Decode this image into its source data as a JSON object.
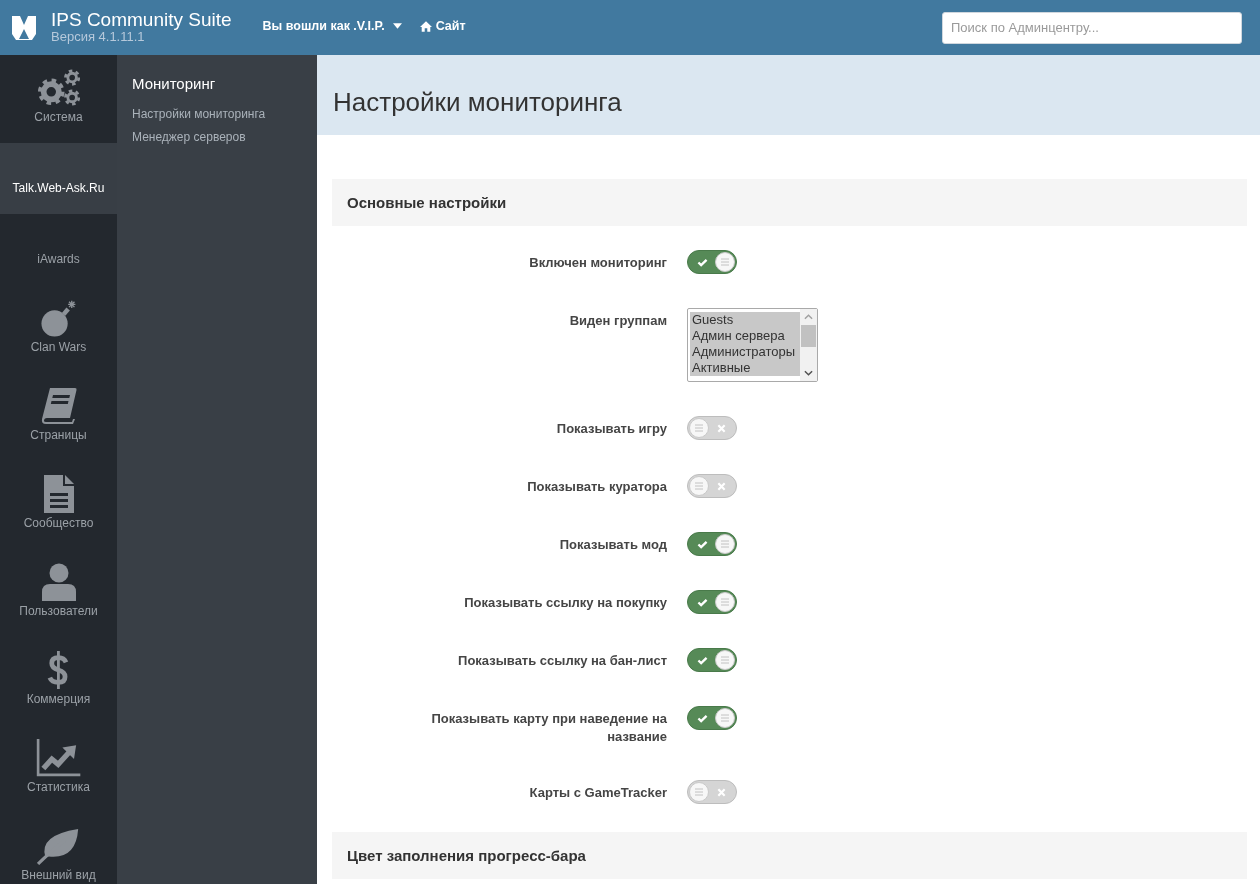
{
  "header": {
    "app_title": "IPS Community Suite",
    "version": "Версия 4.1.11.1",
    "user_menu": "Вы вошли как .V.I.P.",
    "site_link": "Сайт",
    "search": {
      "placeholder": "Поиск по Админцентру..."
    }
  },
  "main_nav": [
    {
      "label": "Система",
      "selected": false
    },
    {
      "label": "Talk.Web-Ask.Ru",
      "selected": true
    },
    {
      "label": "iAwards",
      "selected": false
    },
    {
      "label": "Clan Wars",
      "selected": false
    },
    {
      "label": "Страницы",
      "selected": false
    },
    {
      "label": "Сообщество",
      "selected": false
    },
    {
      "label": "Пользователи",
      "selected": false
    },
    {
      "label": "Коммерция",
      "selected": false
    },
    {
      "label": "Статистика",
      "selected": false
    },
    {
      "label": "Внешний вид",
      "selected": false
    }
  ],
  "sub_nav": {
    "title": "Мониторинг",
    "items": [
      {
        "label": "Настройки мониторинга"
      },
      {
        "label": "Менеджер серверов"
      }
    ]
  },
  "page": {
    "title": "Настройки мониторинга"
  },
  "sections": [
    {
      "title": "Основные настройки",
      "fields": [
        {
          "kind": "toggle",
          "label": "Включен мониторинг",
          "on": true
        },
        {
          "kind": "multiselect",
          "label": "Виден группам",
          "options": [
            {
              "label": "Guests",
              "selected": true
            },
            {
              "label": "Админ сервера",
              "selected": true
            },
            {
              "label": "Администраторы",
              "selected": true
            },
            {
              "label": "Активные",
              "selected": true
            }
          ]
        },
        {
          "kind": "toggle",
          "label": "Показывать игру",
          "on": false
        },
        {
          "kind": "toggle",
          "label": "Показывать куратора",
          "on": false
        },
        {
          "kind": "toggle",
          "label": "Показывать мод",
          "on": true
        },
        {
          "kind": "toggle",
          "label": "Показывать ссылку на покупку",
          "on": true
        },
        {
          "kind": "toggle",
          "label": "Показывать ссылку на бан-лист",
          "on": true
        },
        {
          "kind": "toggle",
          "label": "Показывать карту при наведение на название",
          "on": true
        },
        {
          "kind": "toggle",
          "label": "Карты с GameTracker",
          "on": false
        }
      ]
    },
    {
      "title": "Цвет заполнения прогресс-бара"
    }
  ]
}
